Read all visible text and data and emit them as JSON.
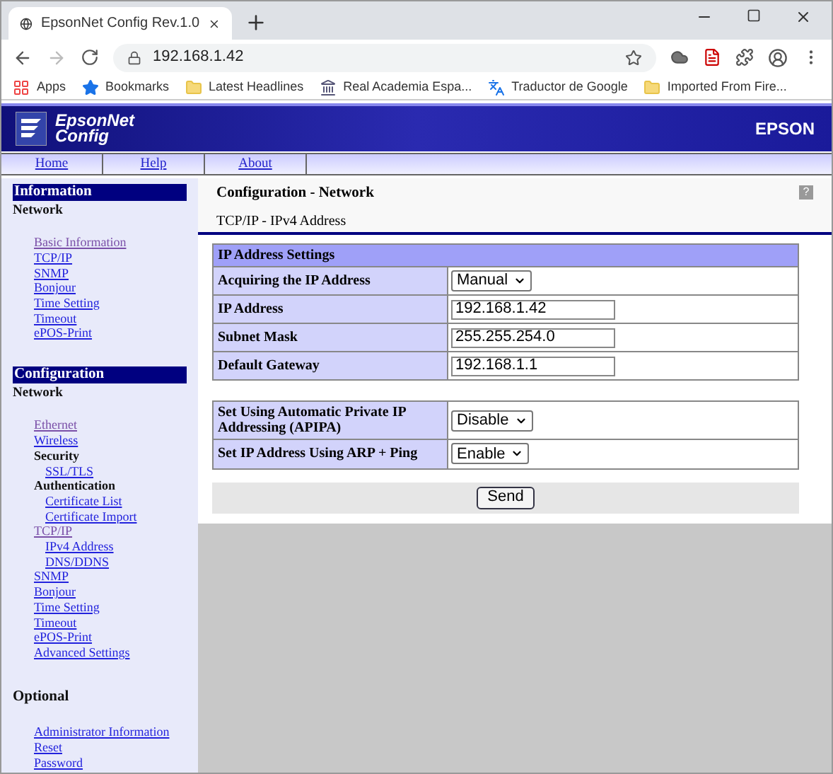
{
  "browser": {
    "tab_title": "EpsonNet Config Rev.1.0",
    "url": "192.168.1.42",
    "bookmarks": [
      {
        "label": "Apps",
        "kind": "apps"
      },
      {
        "label": "Bookmarks",
        "kind": "star"
      },
      {
        "label": "Latest Headlines",
        "kind": "folder"
      },
      {
        "label": "Real Academia Espa...",
        "kind": "site"
      },
      {
        "label": "Traductor de Google",
        "kind": "translate"
      },
      {
        "label": "Imported From Fire...",
        "kind": "folder"
      }
    ]
  },
  "header": {
    "product_lines": [
      "EpsonNet",
      "Config"
    ],
    "brand": "EPSON"
  },
  "nav": [
    "Home",
    "Help",
    "About"
  ],
  "sidebar": [
    {
      "title": "Information",
      "subtitle": "Network",
      "items": [
        {
          "label": "Basic Information",
          "kind": "link",
          "visited": true
        },
        {
          "label": "TCP/IP",
          "kind": "link",
          "visited": false
        },
        {
          "label": "SNMP",
          "kind": "link",
          "visited": false
        },
        {
          "label": "Bonjour",
          "kind": "link",
          "visited": false
        },
        {
          "label": "Time Setting",
          "kind": "link",
          "visited": false
        },
        {
          "label": "Timeout",
          "kind": "link",
          "visited": false
        },
        {
          "label": "ePOS-Print",
          "kind": "link",
          "visited": false
        }
      ]
    },
    {
      "title": "Configuration",
      "subtitle": "Network",
      "items": [
        {
          "label": "Ethernet",
          "kind": "link",
          "visited": true
        },
        {
          "label": "Wireless",
          "kind": "link",
          "visited": false
        },
        {
          "label": "Security",
          "kind": "heading",
          "children": [
            {
              "label": "SSL/TLS",
              "kind": "link",
              "visited": false
            }
          ]
        },
        {
          "label": "Authentication",
          "kind": "heading",
          "children": [
            {
              "label": "Certificate List",
              "kind": "link",
              "visited": false
            },
            {
              "label": "Certificate Import",
              "kind": "link",
              "visited": false
            }
          ]
        },
        {
          "label": "TCP/IP",
          "kind": "link",
          "visited": true,
          "children": [
            {
              "label": "IPv4 Address",
              "kind": "link",
              "visited": false
            },
            {
              "label": "DNS/DDNS",
              "kind": "link",
              "visited": false
            }
          ]
        },
        {
          "label": "SNMP",
          "kind": "link",
          "visited": false
        },
        {
          "label": "Bonjour",
          "kind": "link",
          "visited": false
        },
        {
          "label": "Time Setting",
          "kind": "link",
          "visited": false
        },
        {
          "label": "Timeout",
          "kind": "link",
          "visited": false
        },
        {
          "label": "ePOS-Print",
          "kind": "link",
          "visited": false
        },
        {
          "label": "Advanced Settings",
          "kind": "link",
          "visited": false
        }
      ]
    },
    {
      "subtitle": "Optional",
      "items": [
        {
          "label": "Administrator Information",
          "kind": "link",
          "visited": false
        },
        {
          "label": "Reset",
          "kind": "link",
          "visited": false
        },
        {
          "label": "Password",
          "kind": "link",
          "visited": false
        }
      ]
    }
  ],
  "main": {
    "title": "Configuration - Network",
    "subtitle": "TCP/IP - IPv4 Address",
    "help": "?",
    "tables": [
      {
        "header": "IP Address Settings",
        "rows": [
          {
            "label": "Acquiring the IP Address",
            "kind": "select",
            "value": "Manual"
          },
          {
            "label": "IP Address",
            "kind": "input",
            "value": "192.168.1.42"
          },
          {
            "label": "Subnet Mask",
            "kind": "input",
            "value": "255.255.254.0"
          },
          {
            "label": "Default Gateway",
            "kind": "input",
            "value": "192.168.1.1"
          }
        ]
      },
      {
        "rows": [
          {
            "label": "Set Using Automatic Private IP Addressing (APIPA)",
            "kind": "select",
            "value": "Disable"
          },
          {
            "label": "Set IP Address Using ARP + Ping",
            "kind": "select",
            "value": "Enable"
          }
        ]
      }
    ],
    "send_button": "Send"
  }
}
